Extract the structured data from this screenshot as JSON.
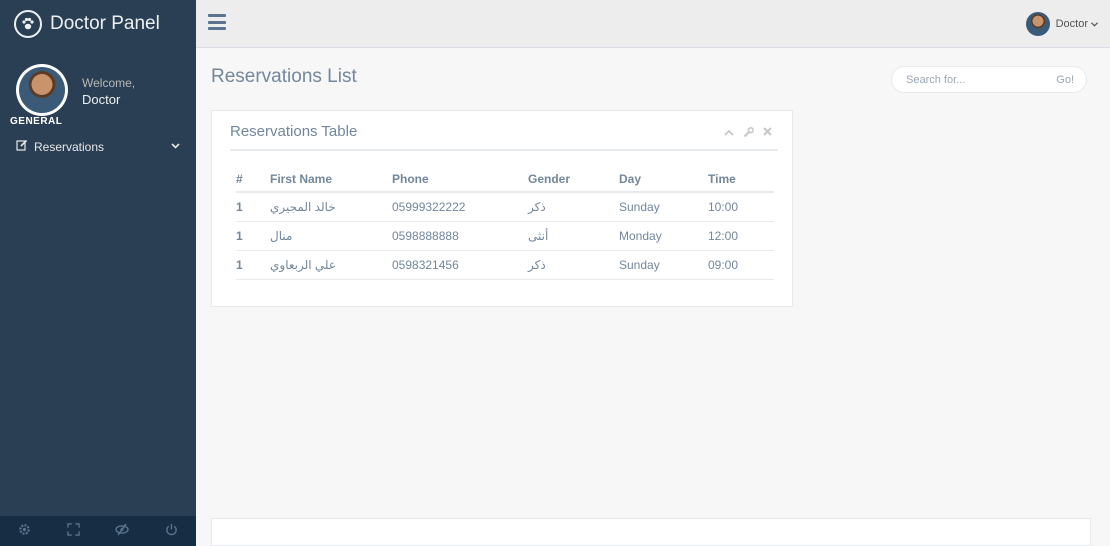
{
  "brand": {
    "title": "Doctor Panel"
  },
  "profile": {
    "welcome": "Welcome,",
    "name": "Doctor"
  },
  "sidebar": {
    "section_title": "GENERAL",
    "items": [
      {
        "label": "Reservations"
      }
    ]
  },
  "topnav": {
    "user_label": "Doctor"
  },
  "page": {
    "title": "Reservations List"
  },
  "search": {
    "placeholder": "Search for...",
    "button": "Go!"
  },
  "panel": {
    "title": "Reservations Table",
    "headers": [
      "#",
      "First Name",
      "Phone",
      "Gender",
      "Day",
      "Time"
    ],
    "rows": [
      [
        "1",
        "خالد المجيري",
        "05999322222",
        "ذكر",
        "Sunday",
        "10:00"
      ],
      [
        "1",
        "منال",
        "0598888888",
        "أنثى",
        "Monday",
        "12:00"
      ],
      [
        "1",
        "علي الربعاوي",
        "0598321456",
        "ذكر",
        "Sunday",
        "09:00"
      ]
    ]
  },
  "icons": {
    "brand": "paw-icon",
    "menu": "edit-icon",
    "footer": [
      "gear-icon",
      "fullscreen-icon",
      "eye-slash-icon",
      "power-icon"
    ]
  },
  "colors": {
    "sidebar": "#2a3f54",
    "sidebar_footer": "#172d44",
    "topnav": "#ededed",
    "text": "#73879c"
  }
}
